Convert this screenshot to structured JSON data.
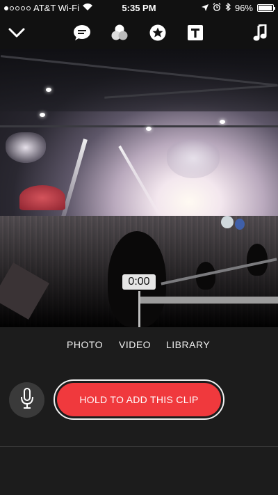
{
  "status_bar": {
    "carrier": "AT&T Wi-Fi",
    "time": "5:35 PM",
    "battery_percent": "96%",
    "battery_level": 0.96,
    "signal_bars_filled": 1,
    "signal_bars_total": 5
  },
  "toolbar": {
    "items": [
      {
        "name": "collapse",
        "icon": "chevron-down-icon"
      },
      {
        "name": "captions",
        "icon": "speech-bubble-icon"
      },
      {
        "name": "filters",
        "icon": "filters-icon"
      },
      {
        "name": "stickers",
        "icon": "star-badge-icon"
      },
      {
        "name": "title",
        "icon": "title-t-icon"
      },
      {
        "name": "music",
        "icon": "music-note-icon"
      }
    ]
  },
  "preview": {
    "timer": "0:00"
  },
  "modes": {
    "photo": "PHOTO",
    "video": "VIDEO",
    "library": "LIBRARY"
  },
  "record": {
    "label": "HOLD TO ADD THIS CLIP"
  },
  "colors": {
    "record_red": "#f0393d",
    "background": "#1c1c1c",
    "toolbar": "#111111"
  }
}
